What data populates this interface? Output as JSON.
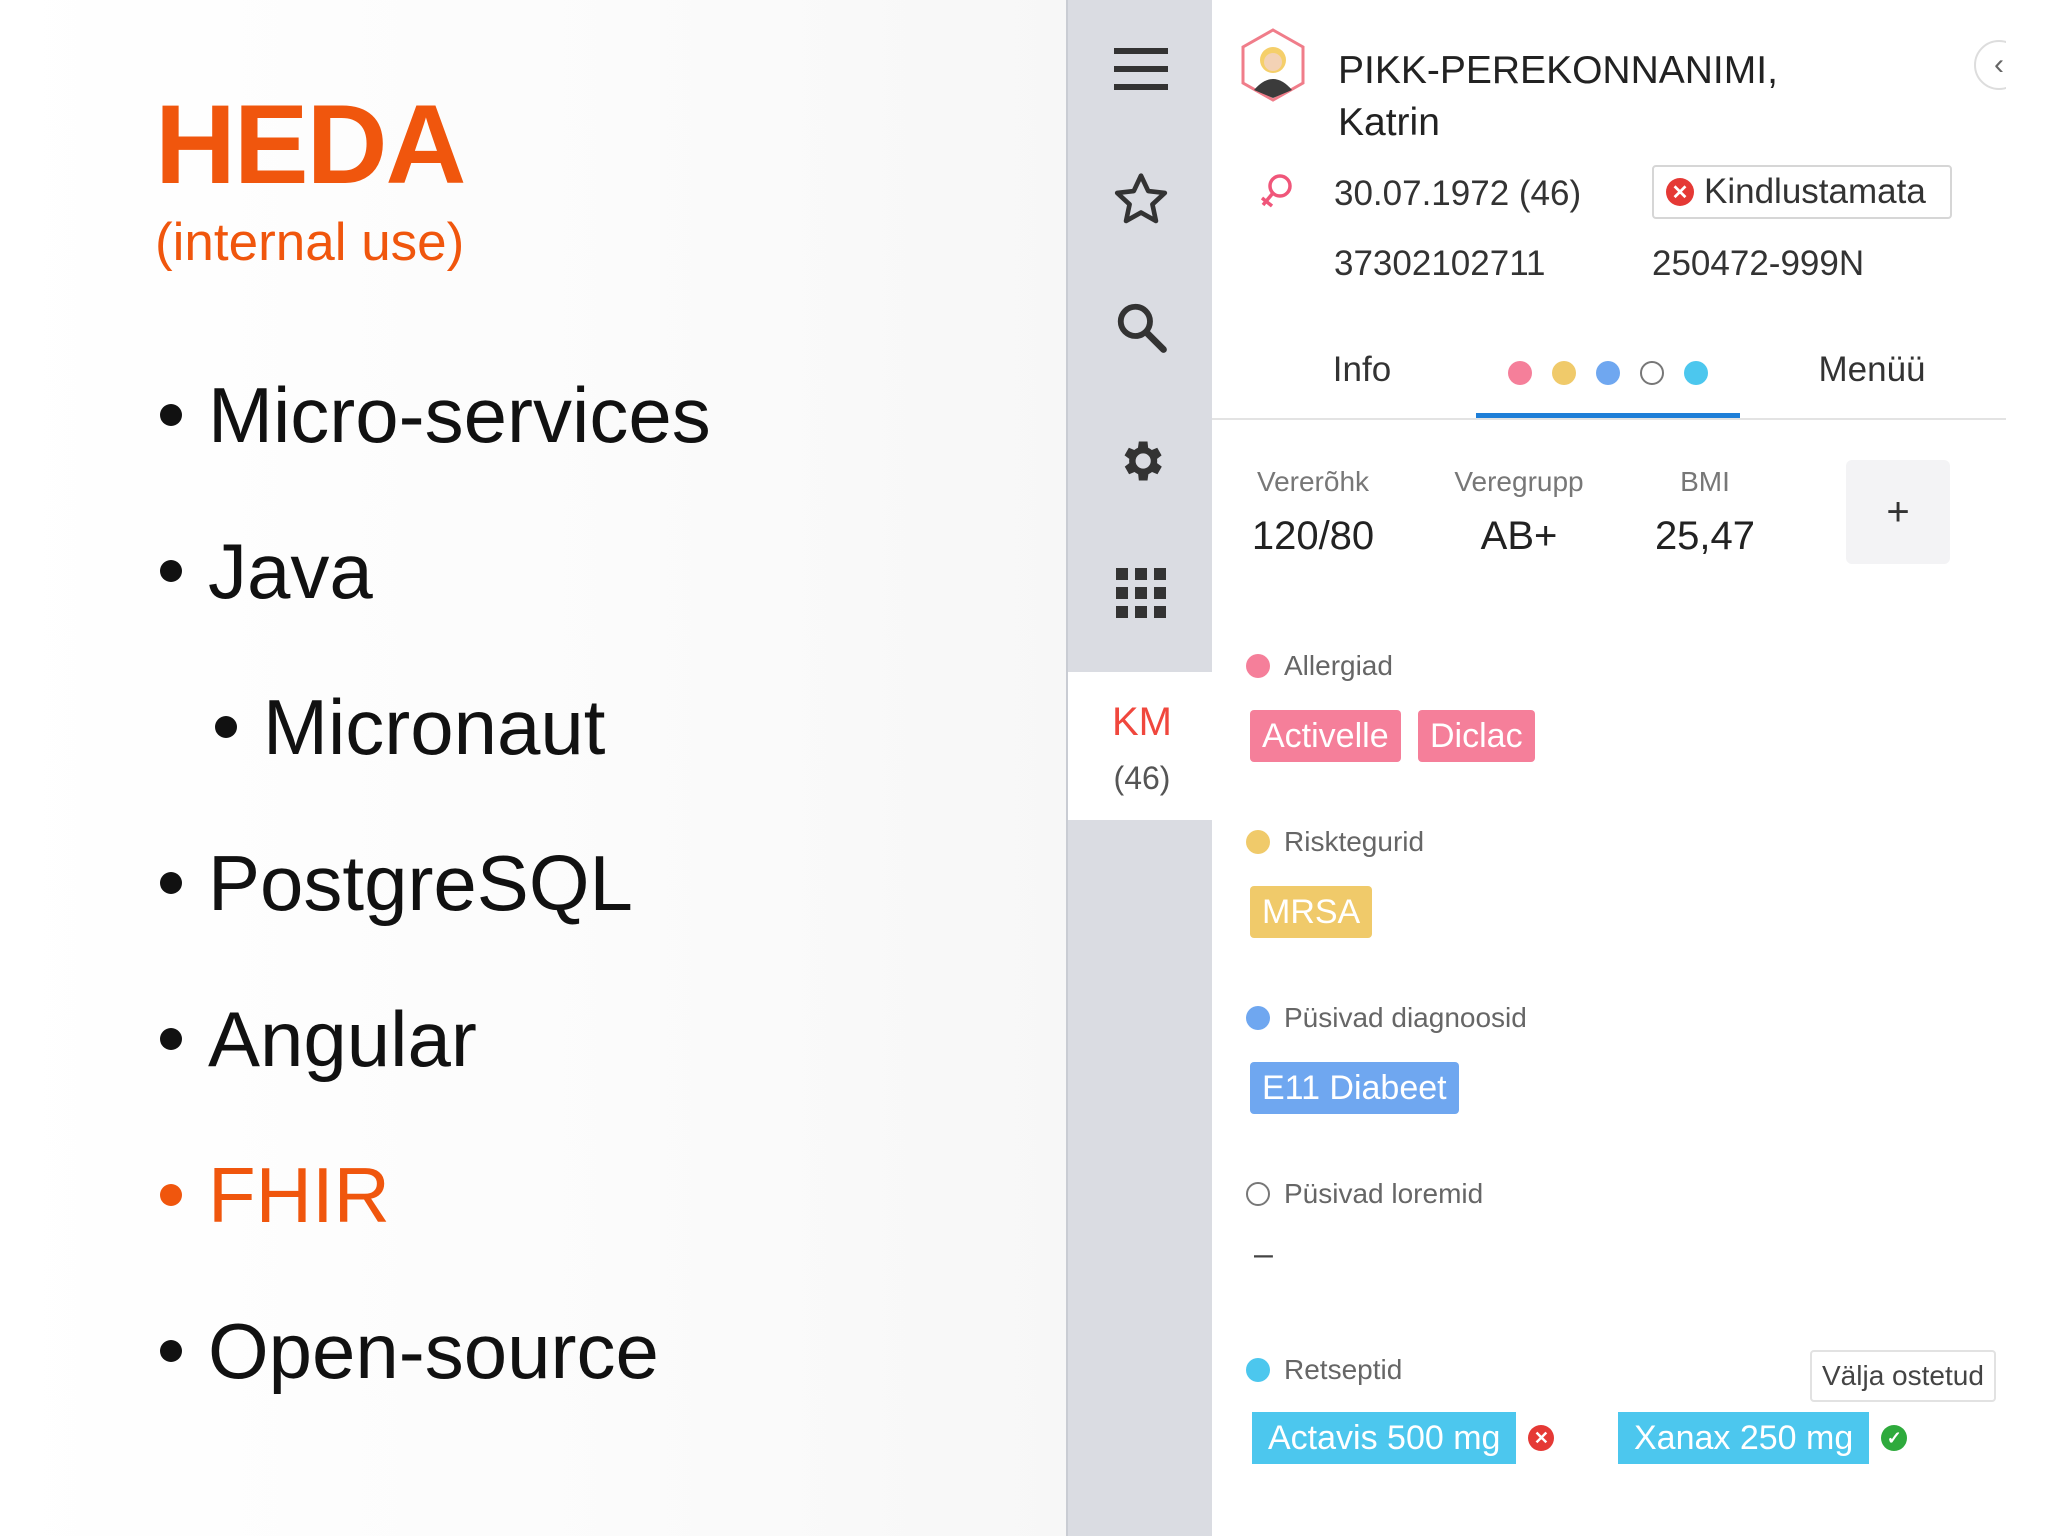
{
  "slide": {
    "title": "HEDA",
    "subtitle": "(internal use)",
    "bullets": [
      {
        "text": "Micro-services",
        "highlight": false
      },
      {
        "text": "Java",
        "highlight": false
      },
      {
        "text": "Micronaut",
        "highlight": false
      },
      {
        "text": "PostgreSQL",
        "highlight": false
      },
      {
        "text": "Angular",
        "highlight": false
      },
      {
        "text": "FHIR",
        "highlight": true
      },
      {
        "text": "Open-source",
        "highlight": false
      }
    ],
    "accent_color": "#f0560d"
  },
  "rail": {
    "icons": [
      "menu-icon",
      "star-icon",
      "search-icon",
      "gear-icon",
      "grid-icon"
    ],
    "active_initials": "KM",
    "active_age": "(46)"
  },
  "patient": {
    "name_line1": "PIKK-PEREKONNANIMI,",
    "name_line2": "Katrin",
    "dob": "30.07.1972 (46)",
    "id_code": "37302102711",
    "insurance_status": "Kindlustamata",
    "code2": "250472-999N",
    "gender_icon": "female-icon"
  },
  "tabs": {
    "info": "Info",
    "menu": "Menüü",
    "dot_colors": [
      "#f57f9a",
      "#f0ca6a",
      "#6fa7f0",
      "#ffffff",
      "#4cc7ee"
    ]
  },
  "vitals": [
    {
      "label": "Vererõhk",
      "value": "120/80"
    },
    {
      "label": "Veregrupp",
      "value": "AB+"
    },
    {
      "label": "BMI",
      "value": "25,47"
    }
  ],
  "add_label": "+",
  "sections": {
    "allergies": {
      "title": "Allergiad",
      "color": "#f57f9a",
      "chips": [
        "Activelle",
        "Diclac"
      ]
    },
    "risk": {
      "title": "Risktegurid",
      "color": "#f0ca6a",
      "chips": [
        "MRSA"
      ]
    },
    "diagnoses": {
      "title": "Püsivad diagnoosid",
      "color": "#6fa7f0",
      "chips": [
        "E11 Diabeet"
      ]
    },
    "other": {
      "title": "Püsivad loremid",
      "color": "#ffffff",
      "empty": "–"
    },
    "prescriptions": {
      "title": "Retseptid",
      "color": "#4cc7ee",
      "items": [
        {
          "name": "Actavis 500 mg",
          "status": "not-purchased"
        },
        {
          "name": "Xanax 250 mg",
          "status": "purchased"
        }
      ],
      "tooltip": "Välja ostetud"
    }
  }
}
